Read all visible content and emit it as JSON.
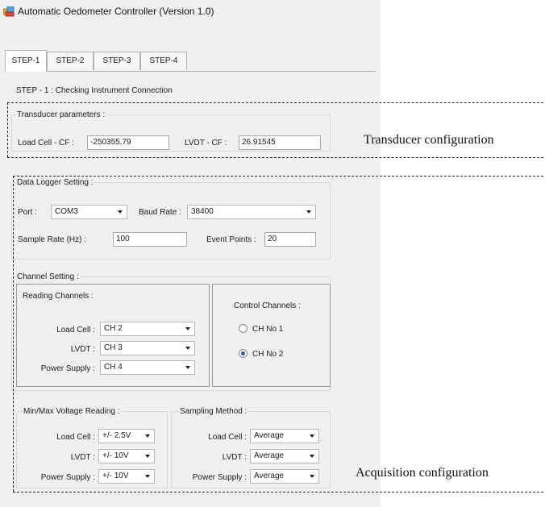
{
  "window": {
    "title": "Automatic Oedometer Controller (Version 1.0)",
    "icon": "app-icon"
  },
  "tabs": [
    "STEP-1",
    "STEP-2",
    "STEP-3",
    "STEP-4"
  ],
  "active_tab": "STEP-1",
  "step_title": "STEP - 1 : Checking Instrument Connection",
  "transducer": {
    "group_label": "Transducer parameters :",
    "load_cell_label": "Load Cell - CF :",
    "load_cell_value": "-250355.79",
    "lvdt_label": "LVDT - CF :",
    "lvdt_value": "26.91545"
  },
  "data_logger": {
    "group_label": "Data Logger Setting :",
    "port_label": "Port :",
    "port_value": "COM3",
    "baud_label": "Baud Rate :",
    "baud_value": "38400",
    "sample_rate_label": "Sample Rate (Hz) :",
    "sample_rate_value": "100",
    "event_points_label": "Event Points :",
    "event_points_value": "20"
  },
  "channel_setting": {
    "group_label": "Channel Setting :",
    "reading": {
      "label": "Reading Channels :",
      "rows": [
        {
          "label": "Load Cell :",
          "value": "CH 2"
        },
        {
          "label": "LVDT :",
          "value": "CH 3"
        },
        {
          "label": "Power Supply :",
          "value": "CH 4"
        }
      ]
    },
    "control": {
      "label": "Control Channels :",
      "options": [
        {
          "label": "CH No 1",
          "selected": false
        },
        {
          "label": "CH No 2",
          "selected": true
        }
      ]
    }
  },
  "voltage": {
    "group_label": "Min/Max Voltage Reading :",
    "rows": [
      {
        "label": "Load Cell :",
        "value": "+/- 2.5V"
      },
      {
        "label": "LVDT :",
        "value": "+/- 10V"
      },
      {
        "label": "Power Supply :",
        "value": "+/- 10V"
      }
    ]
  },
  "sampling": {
    "group_label": "Sampling Method :",
    "rows": [
      {
        "label": "Load Cell :",
        "value": "Average"
      },
      {
        "label": "LVDT :",
        "value": "Average"
      },
      {
        "label": "Power Supply :",
        "value": "Average"
      }
    ]
  },
  "annotations": {
    "transducer": "Transducer configuration",
    "acquisition": "Acquisition configuration"
  },
  "colors": {
    "radio_selected": "#1c66b8",
    "window_bg": "#f0f0f0"
  }
}
